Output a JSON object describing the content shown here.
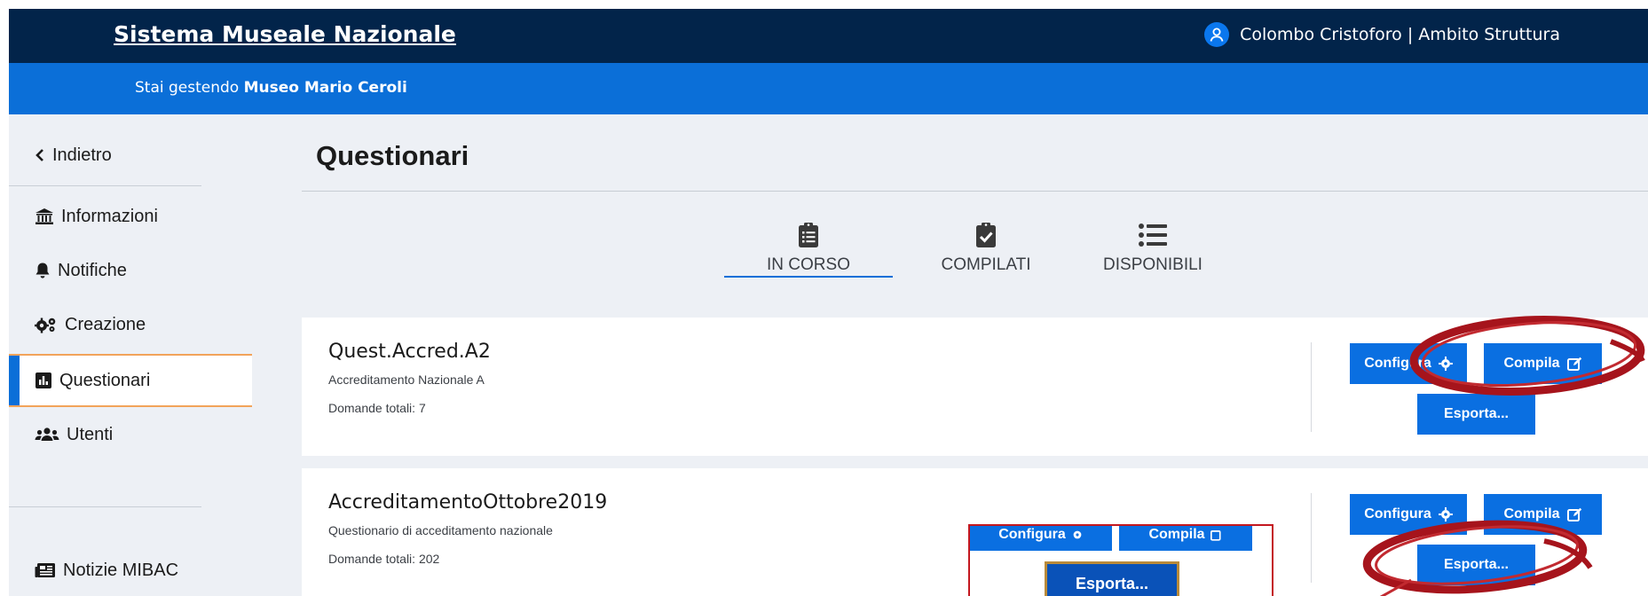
{
  "header": {
    "brand": "Sistema Museale Nazionale",
    "user": "Colombo Cristoforo | Ambito Struttura"
  },
  "subheader": {
    "prefix": "Stai gestendo",
    "museum": "Museo Mario Ceroli"
  },
  "sidebar": {
    "back": "Indietro",
    "items": [
      {
        "label": "Informazioni",
        "icon": "museum-icon"
      },
      {
        "label": "Notifiche",
        "icon": "bell-icon"
      },
      {
        "label": "Creazione",
        "icon": "gears-icon"
      },
      {
        "label": "Questionari",
        "icon": "chart-icon",
        "active": true
      },
      {
        "label": "Utenti",
        "icon": "users-icon"
      }
    ],
    "news": "Notizie MIBAC"
  },
  "main": {
    "title": "Questionari",
    "tabs": [
      {
        "label": "IN CORSO",
        "icon": "clipboard-list-icon",
        "active": true
      },
      {
        "label": "COMPILATI",
        "icon": "clipboard-check-icon"
      },
      {
        "label": "DISPONIBILI",
        "icon": "list-icon"
      }
    ],
    "cards": [
      {
        "title": "Quest.Accred.A2",
        "subtitle": "Accreditamento Nazionale A",
        "count": "Domande totali: 7",
        "configure_label": "Configura",
        "compile_label": "Compila",
        "export_label": "Esporta..."
      },
      {
        "title": "AccreditamentoOttobre2019",
        "subtitle": "Questionario di acceditamento nazionale",
        "count": "Domande totali: 202",
        "configure_label": "Configura",
        "compile_label": "Compila",
        "export_label": "Esporta..."
      }
    ],
    "inset": {
      "configure_label": "Configura",
      "compile_label": "Compila",
      "export_label": "Esporta..."
    }
  },
  "colors": {
    "topbar": "#02244a",
    "subbar": "#0b6fd8",
    "button": "#0a6fe1",
    "accent_orange": "#f2a35a",
    "annotation_red": "#b01820"
  }
}
